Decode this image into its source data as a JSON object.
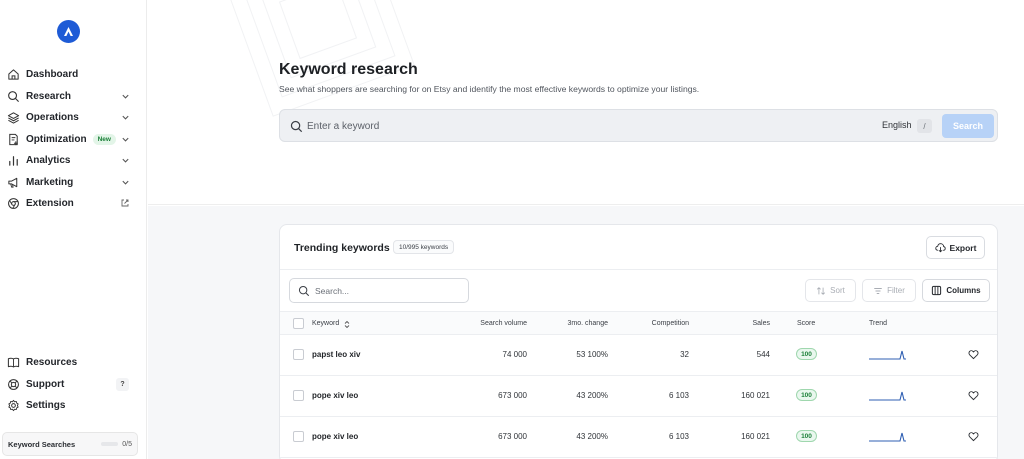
{
  "sidebar": {
    "items": [
      {
        "label": "Dashboard",
        "icon": "home-icon"
      },
      {
        "label": "Research",
        "icon": "search-icon"
      },
      {
        "label": "Operations",
        "icon": "layers-icon"
      },
      {
        "label": "Optimization",
        "icon": "document-plus-icon",
        "badge": "New"
      },
      {
        "label": "Analytics",
        "icon": "bar-chart-icon"
      },
      {
        "label": "Marketing",
        "icon": "megaphone-icon"
      },
      {
        "label": "Extension",
        "icon": "chrome-icon"
      }
    ],
    "bottom_items": [
      {
        "label": "Resources",
        "icon": "book-icon"
      },
      {
        "label": "Support",
        "icon": "lifebuoy-icon",
        "shortcut": "?"
      },
      {
        "label": "Settings",
        "icon": "gear-icon"
      }
    ],
    "keyword_searches": {
      "label": "Keyword Searches",
      "count": "0/5",
      "progress": 0
    }
  },
  "header": {
    "title": "Keyword research",
    "subtitle": "See what shoppers are searching for on Etsy and identify the most effective keywords to optimize your listings.",
    "search_placeholder": "Enter a keyword",
    "language": "English",
    "shortcut": "/",
    "search_button": "Search"
  },
  "trending": {
    "title": "Trending keywords",
    "count_badge": "10/995 keywords",
    "export_label": "Export",
    "search_placeholder": "Search...",
    "sort_label": "Sort",
    "filter_label": "Filter",
    "columns_label": "Columns",
    "columns": [
      "Keyword",
      "Search volume",
      "3mo. change",
      "Competition",
      "Sales",
      "Score",
      "Trend"
    ],
    "rows": [
      {
        "keyword": "papst leo xiv",
        "volume": "74 000",
        "change": "53 100%",
        "competition": "32",
        "sales": "544",
        "score": "100"
      },
      {
        "keyword": "pope xiv leo",
        "volume": "673 000",
        "change": "43 200%",
        "competition": "6 103",
        "sales": "160 021",
        "score": "100"
      },
      {
        "keyword": "pope xiv leo",
        "volume": "673 000",
        "change": "43 200%",
        "competition": "6 103",
        "sales": "160 021",
        "score": "100"
      }
    ]
  },
  "colors": {
    "accent": "#1e5bd6",
    "search_button": "#b7d2f7",
    "score_green": "#1a7f37",
    "trend_line": "#2f5fb3"
  }
}
